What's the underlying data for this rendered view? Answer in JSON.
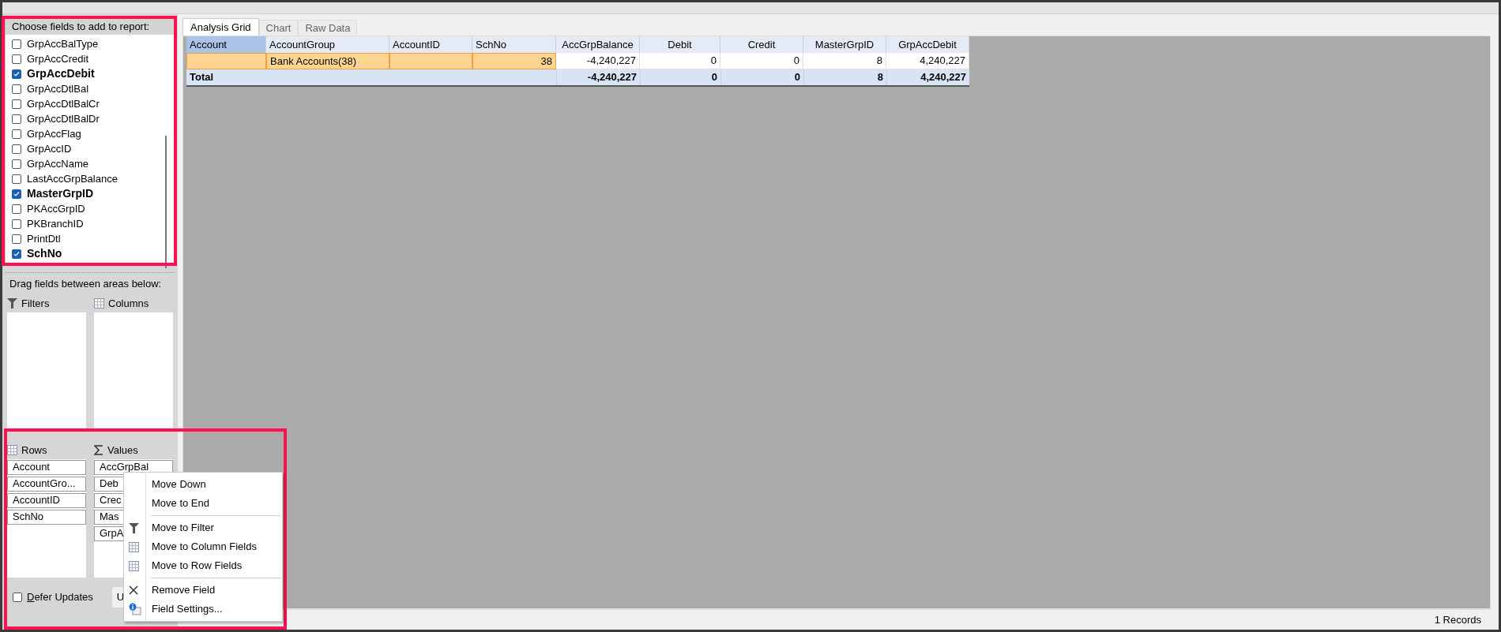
{
  "field_list": {
    "title": "Choose fields to add to report:",
    "items": [
      {
        "label": "GrpAccBalType",
        "checked": false
      },
      {
        "label": "GrpAccCredit",
        "checked": false
      },
      {
        "label": "GrpAccDebit",
        "checked": true
      },
      {
        "label": "GrpAccDtlBal",
        "checked": false
      },
      {
        "label": "GrpAccDtlBalCr",
        "checked": false
      },
      {
        "label": "GrpAccDtlBalDr",
        "checked": false
      },
      {
        "label": "GrpAccFlag",
        "checked": false
      },
      {
        "label": "GrpAccID",
        "checked": false
      },
      {
        "label": "GrpAccName",
        "checked": false
      },
      {
        "label": "LastAccGrpBalance",
        "checked": false
      },
      {
        "label": "MasterGrpID",
        "checked": true
      },
      {
        "label": "PKAccGrpID",
        "checked": false
      },
      {
        "label": "PKBranchID",
        "checked": false
      },
      {
        "label": "PrintDtl",
        "checked": false
      },
      {
        "label": "SchNo",
        "checked": true
      }
    ]
  },
  "areas": {
    "title": "Drag fields between areas below:",
    "filters": {
      "label": "Filters"
    },
    "columns": {
      "label": "Columns"
    },
    "rows": {
      "label": "Rows",
      "items": [
        "Account",
        "AccountGro...",
        "AccountID",
        "SchNo"
      ]
    },
    "values": {
      "label": "Values",
      "items": [
        "AccGrpBal",
        "Deb",
        "Crec",
        "Mas",
        "GrpA"
      ]
    },
    "defer_updates": {
      "label": "Defer Updates",
      "checked": false
    },
    "update_button": {
      "label": "U"
    }
  },
  "tabs": [
    {
      "label": "Analysis Grid",
      "selected": true
    },
    {
      "label": "Chart",
      "selected": false
    },
    {
      "label": "Raw Data",
      "selected": false
    }
  ],
  "grid": {
    "columns": [
      {
        "label": "Account",
        "selected": true
      },
      {
        "label": "AccountGroup",
        "selected": false
      },
      {
        "label": "AccountID",
        "selected": false
      },
      {
        "label": "SchNo",
        "selected": false
      },
      {
        "label": "AccGrpBalance",
        "selected": false
      },
      {
        "label": "Debit",
        "selected": false
      },
      {
        "label": "Credit",
        "selected": false
      },
      {
        "label": "MasterGrpID",
        "selected": false
      },
      {
        "label": "GrpAccDebit",
        "selected": false
      }
    ],
    "rows": [
      {
        "account_group": "Bank Accounts(38)",
        "sch_no": "38",
        "values": [
          "-4,240,227",
          "0",
          "0",
          "8",
          "4,240,227"
        ]
      }
    ],
    "total": {
      "label": "Total",
      "values": [
        "-4,240,227",
        "0",
        "0",
        "8",
        "4,240,227"
      ]
    }
  },
  "context_menu": {
    "items": [
      {
        "kind": "plain",
        "label": "Move Down"
      },
      {
        "kind": "plain",
        "label": "Move to End"
      },
      {
        "kind": "separator"
      },
      {
        "kind": "filter",
        "label": "Move to Filter"
      },
      {
        "kind": "columns",
        "label": "Move to Column Fields"
      },
      {
        "kind": "rows",
        "label": "Move to Row Fields"
      },
      {
        "kind": "separator"
      },
      {
        "kind": "remove",
        "label": "Remove Field"
      },
      {
        "kind": "settings",
        "label": "Field Settings..."
      }
    ]
  },
  "status_bar": {
    "records": "1 Records"
  }
}
